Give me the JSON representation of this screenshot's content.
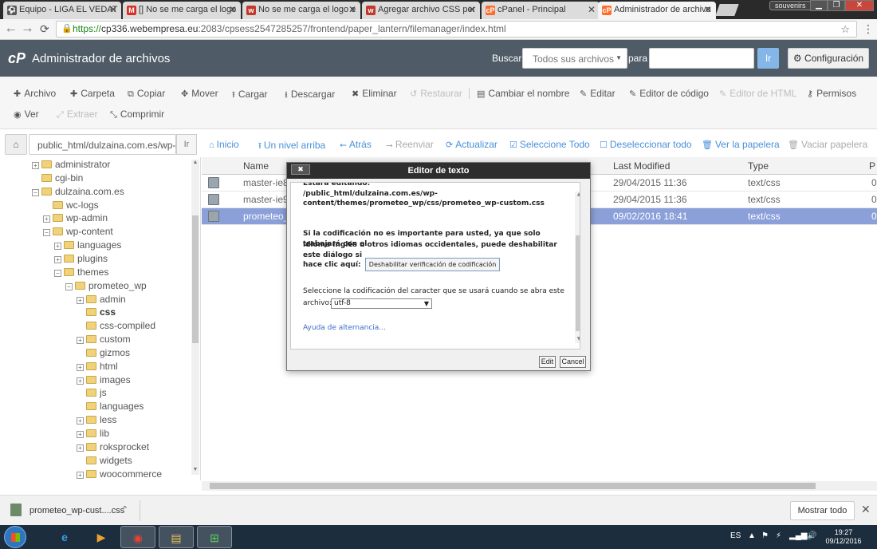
{
  "browser": {
    "tabs": [
      {
        "title": "Equipo - LIGA EL VEDAT",
        "fav_color": "#555555",
        "fav_glyph": "⚽"
      },
      {
        "title": "[] No se me carga el logo",
        "fav_color": "#d93025",
        "fav_glyph": "M"
      },
      {
        "title": "No se me carga el logo e",
        "fav_color": "#c0392b",
        "fav_glyph": "w"
      },
      {
        "title": "Agregar archivo CSS per",
        "fav_color": "#c0392b",
        "fav_glyph": "w"
      },
      {
        "title": "cPanel - Principal",
        "fav_color": "#ff6c2c",
        "fav_glyph": "cP"
      },
      {
        "title": "Administrador de archivo",
        "fav_color": "#ff6c2c",
        "fav_glyph": "cP"
      }
    ],
    "user_label": "souvenirs",
    "url_secure": "https://",
    "url_host": "cp336.webempresa.eu",
    "url_path": ":2083/cpsess2547285257/frontend/paper_lantern/filemanager/index.html"
  },
  "header": {
    "logo": "cP",
    "title": "Administrador de archivos",
    "search_label": "Buscar",
    "search_scope": "Todos sus archivos",
    "para_label": "para",
    "search_value": "",
    "go_label": "Ir",
    "config_label": "Configuración"
  },
  "toolbar": {
    "row1": [
      {
        "icon": "✚",
        "label": "Archivo",
        "enabled": true
      },
      {
        "icon": "✚",
        "label": "Carpeta",
        "enabled": true
      },
      {
        "icon": "⧉",
        "label": "Copiar",
        "enabled": true
      },
      {
        "icon": "✥",
        "label": "Mover",
        "enabled": true
      },
      {
        "icon": "⭱",
        "label": "Cargar",
        "enabled": true
      },
      {
        "icon": "⭳",
        "label": "Descargar",
        "enabled": true
      },
      {
        "icon": "✖",
        "label": "Eliminar",
        "enabled": true
      },
      {
        "icon": "↺",
        "label": "Restaurar",
        "enabled": false
      },
      {
        "icon": "▤",
        "label": "Cambiar el nombre",
        "enabled": true
      },
      {
        "icon": "✎",
        "label": "Editar",
        "enabled": true
      },
      {
        "icon": "✎",
        "label": "Editor de código",
        "enabled": true
      },
      {
        "icon": "✎",
        "label": "Editor de HTML",
        "enabled": false
      },
      {
        "icon": "⚷",
        "label": "Permisos",
        "enabled": true
      }
    ],
    "row2": [
      {
        "icon": "◉",
        "label": "Ver",
        "enabled": true
      },
      {
        "icon": "⤢",
        "label": "Extraer",
        "enabled": false
      },
      {
        "icon": "⤡",
        "label": "Comprimir",
        "enabled": true
      }
    ]
  },
  "pathbar": {
    "path": "public_html/dulzaina.com.es/wp-",
    "go_label": "Ir",
    "actions": [
      {
        "icon": "⌂",
        "label": "Inicio",
        "enabled": true
      },
      {
        "icon": "⭱",
        "label": "Un nivel arriba",
        "enabled": true
      },
      {
        "icon": "⭠",
        "label": "Atrás",
        "enabled": true
      },
      {
        "icon": "⭢",
        "label": "Reenviar",
        "enabled": false
      },
      {
        "icon": "⟳",
        "label": "Actualizar",
        "enabled": true
      },
      {
        "icon": "☑",
        "label": "Seleccione Todo",
        "enabled": true
      },
      {
        "icon": "☐",
        "label": "Deseleccionar todo",
        "enabled": true
      },
      {
        "icon": "🗑",
        "label": "Ver la papelera",
        "enabled": true
      },
      {
        "icon": "🗑",
        "label": "Vaciar papelera",
        "enabled": false
      }
    ]
  },
  "tree": [
    {
      "label": "administrator",
      "expander": "+",
      "bold": false
    },
    {
      "label": "cgi-bin",
      "expander": "",
      "bold": false
    },
    {
      "label": "dulzaina.com.es",
      "expander": "−",
      "bold": false
    },
    {
      "label": "wc-logs",
      "expander": "",
      "bold": false
    },
    {
      "label": "wp-admin",
      "expander": "+",
      "bold": false
    },
    {
      "label": "wp-content",
      "expander": "−",
      "bold": false
    },
    {
      "label": "languages",
      "expander": "+",
      "bold": false
    },
    {
      "label": "plugins",
      "expander": "+",
      "bold": false
    },
    {
      "label": "themes",
      "expander": "−",
      "bold": false
    },
    {
      "label": "prometeo_wp",
      "expander": "−",
      "bold": false
    },
    {
      "label": "admin",
      "expander": "+",
      "bold": false
    },
    {
      "label": "css",
      "expander": "",
      "bold": true
    },
    {
      "label": "css-compiled",
      "expander": "",
      "bold": false
    },
    {
      "label": "custom",
      "expander": "+",
      "bold": false
    },
    {
      "label": "gizmos",
      "expander": "",
      "bold": false
    },
    {
      "label": "html",
      "expander": "+",
      "bold": false
    },
    {
      "label": "images",
      "expander": "+",
      "bold": false
    },
    {
      "label": "js",
      "expander": "",
      "bold": false
    },
    {
      "label": "languages",
      "expander": "",
      "bold": false
    },
    {
      "label": "less",
      "expander": "+",
      "bold": false
    },
    {
      "label": "lib",
      "expander": "+",
      "bold": false
    },
    {
      "label": "roksprocket",
      "expander": "+",
      "bold": false
    },
    {
      "label": "widgets",
      "expander": "",
      "bold": false
    },
    {
      "label": "woocommerce",
      "expander": "+",
      "bold": false
    }
  ],
  "table": {
    "columns": [
      "Name",
      "Last Modified",
      "Type",
      "P"
    ],
    "rows": [
      {
        "name": "master-ie8.",
        "modified": "29/04/2015 11:36",
        "type": "text/css",
        "perm": "0",
        "selected": false
      },
      {
        "name": "master-ie9.",
        "modified": "29/04/2015 11:36",
        "type": "text/css",
        "perm": "0",
        "selected": false
      },
      {
        "name": "prometeo_w",
        "modified": "09/02/2016 18:41",
        "type": "text/css",
        "perm": "0",
        "selected": true
      }
    ]
  },
  "modal": {
    "title": "Editor de texto",
    "close_glyph": "✖",
    "editing_label": "Estará editando:",
    "file_path_1": "/public_html/dulzaina.com.es/wp-",
    "file_path_2": "content/themes/prometeo_wp/css/prometeo_wp-custom.css",
    "info_1": "Si la codificación no es importante para usted, ya que solo trabajará con el",
    "info_2": "idioma inglés u otros idiomas occidentales, puede deshabilitar este diálogo si",
    "info_3": "hace clic aquí:",
    "disable_button": "Deshabilitar verificación de codificación",
    "encoding_label_1": "Seleccione la codificación del caracter que se usará cuando se abra este",
    "encoding_label_2": "archivo:",
    "encoding_value": "utf-8",
    "help_link": "Ayuda de alternancia...",
    "edit_button": "Edit",
    "cancel_button": "Cancel"
  },
  "downloads": {
    "file": "prometeo_wp-cust....css",
    "show_all": "Mostrar todo"
  },
  "taskbar": {
    "language": "ES",
    "time": "19:27",
    "date": "09/12/2016"
  }
}
